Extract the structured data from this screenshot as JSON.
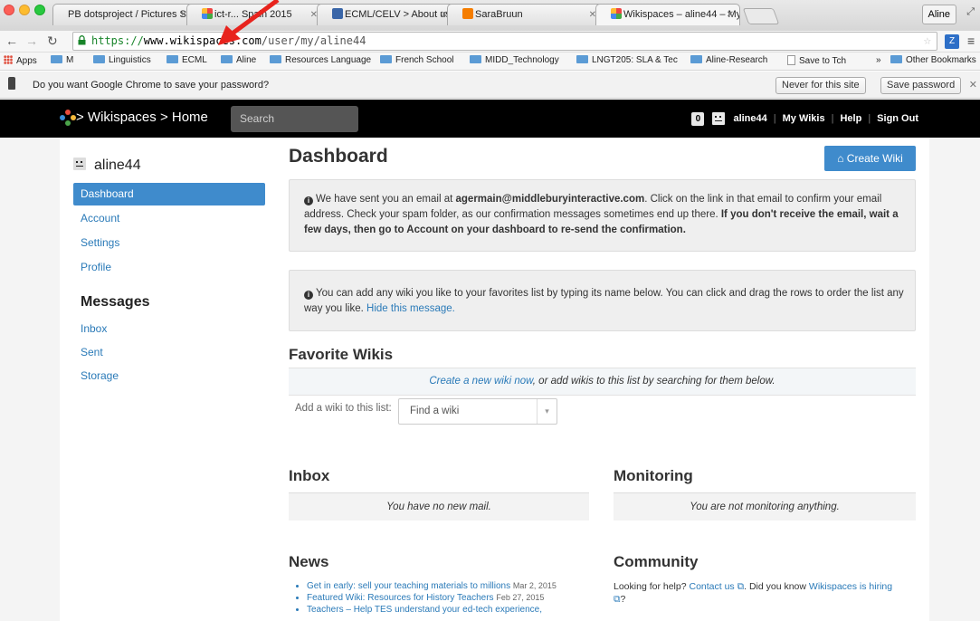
{
  "browser": {
    "tabs": [
      {
        "title": "PB dotsproject / Pictures Swe",
        "active": false
      },
      {
        "title": "ict-r... Spain 2015",
        "active": false
      },
      {
        "title": "ECML/CELV > About us >",
        "active": false
      },
      {
        "title": "SaraBruun",
        "active": false
      },
      {
        "title": "Wikispaces – aline44 – My",
        "active": true
      }
    ],
    "profile_button": "Aline",
    "url_scheme": "https://",
    "url_host": "www.wikispaces.com",
    "url_path": "/user/my/aline44",
    "bookmarks": [
      {
        "label": "Apps",
        "type": "apps"
      },
      {
        "label": "M",
        "type": "folder"
      },
      {
        "label": "Linguistics",
        "type": "folder"
      },
      {
        "label": "ECML",
        "type": "folder"
      },
      {
        "label": "Aline",
        "type": "folder"
      },
      {
        "label": "Resources Language",
        "type": "folder"
      },
      {
        "label": "French School",
        "type": "folder"
      },
      {
        "label": "MIDD_Technology",
        "type": "folder"
      },
      {
        "label": "LNGT205: SLA & Tec",
        "type": "folder"
      },
      {
        "label": "Aline-Research",
        "type": "folder"
      },
      {
        "label": "Save to Tch",
        "type": "page"
      },
      {
        "label": "»",
        "type": "more"
      },
      {
        "label": "Other Bookmarks",
        "type": "folder"
      }
    ],
    "password_prompt": {
      "text": "Do you want Google Chrome to save your password?",
      "never_button": "Never for this site",
      "save_button": "Save password"
    }
  },
  "site": {
    "breadcrumb": "> Wikispaces > Home",
    "search_placeholder": "Search",
    "notification_count": "0",
    "username": "aline44",
    "nav_links": [
      "My Wikis",
      "Help",
      "Sign Out"
    ]
  },
  "sidebar": {
    "user": "aline44",
    "account_items": [
      "Dashboard",
      "Account",
      "Settings",
      "Profile"
    ],
    "messages_heading": "Messages",
    "message_items": [
      "Inbox",
      "Sent",
      "Storage"
    ]
  },
  "main": {
    "title": "Dashboard",
    "create_button": "Create Wiki",
    "email_alert": {
      "part1": "We have sent you an email at ",
      "email": "agermain@middleburyinteractive.com",
      "part2": ". Click on the link in that email to confirm your email address. Check your spam folder, as our confirmation messages sometimes end up there. ",
      "bold": "If you don't receive the email, wait a few days, then go to Account on your dashboard to re-send the confirmation."
    },
    "favorites_alert": {
      "text": "You can add any wiki you like to your favorites list by typing its name below. You can click and drag the rows to order the list any way you like. ",
      "hide_link": "Hide this message."
    },
    "favorite_wikis": {
      "heading": "Favorite Wikis",
      "create_link": "Create a new wiki now",
      "bar_text": ", or add wikis to this list by searching for them below.",
      "add_label": "Add a wiki to this list:",
      "find_placeholder": "Find a wiki"
    },
    "inbox": {
      "heading": "Inbox",
      "empty": "You have no new mail."
    },
    "monitoring": {
      "heading": "Monitoring",
      "empty": "You are not monitoring anything."
    },
    "news": {
      "heading": "News",
      "items": [
        {
          "title": "Get in early: sell your teaching materials to millions",
          "date": "Mar 2, 2015"
        },
        {
          "title": "Featured Wiki: Resources for History Teachers",
          "date": "Feb 27, 2015"
        },
        {
          "title": "Teachers – Help TES understand your ed-tech experience,",
          "date": ""
        }
      ]
    },
    "community": {
      "heading": "Community",
      "t1": "Looking for help? ",
      "contact_link": "Contact us",
      "t2": ". Did you know ",
      "hiring_link": "Wikispaces is hiring",
      "t3": "?"
    }
  },
  "colors": {
    "accent": "#3f8bcc",
    "link": "#2a7ab8",
    "annotation_arrow": "#e8231d"
  }
}
